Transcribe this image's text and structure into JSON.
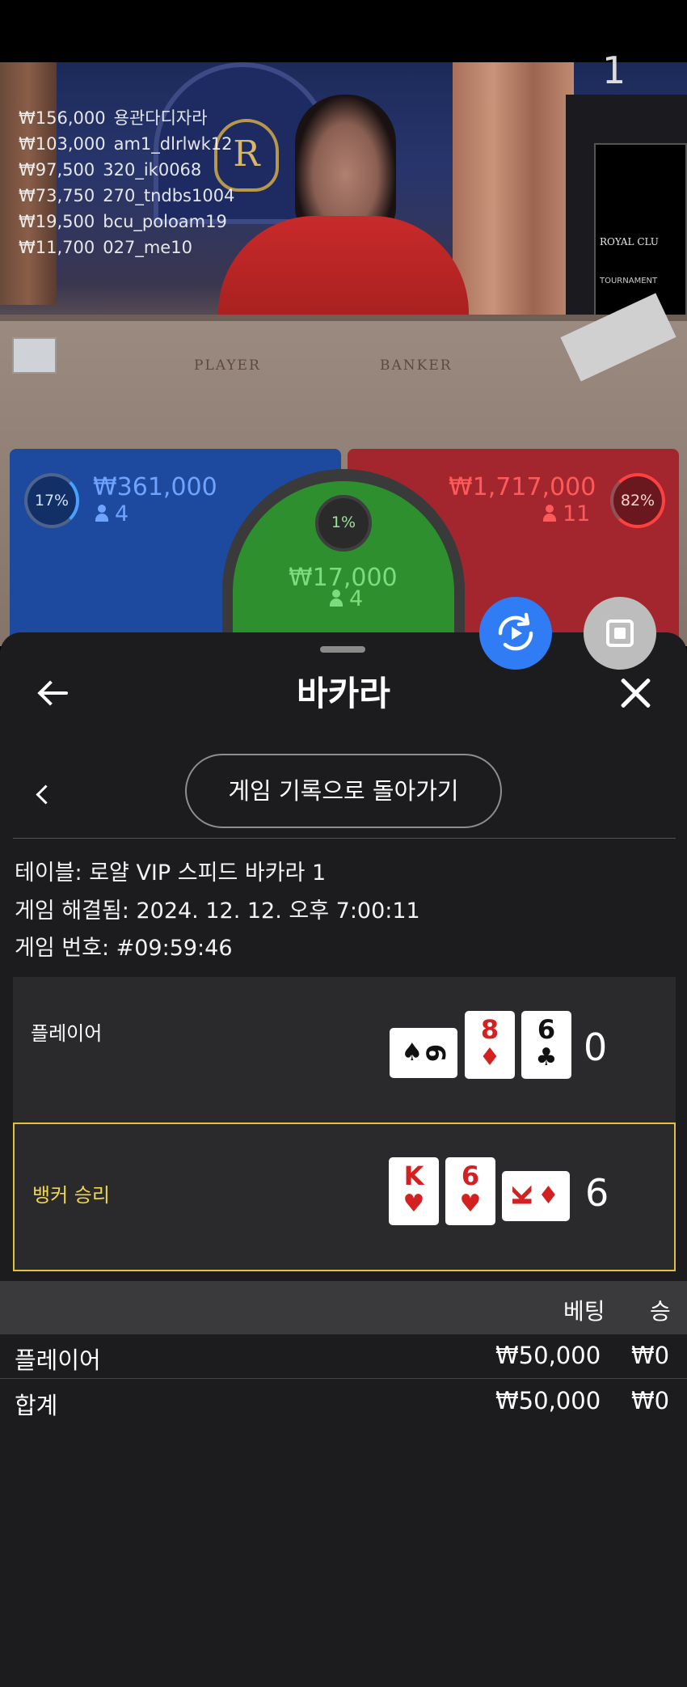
{
  "stage": {
    "round_number": "1",
    "leaderboard": [
      {
        "amount": "₩156,000",
        "user": "용관다디자라"
      },
      {
        "amount": "₩103,000",
        "user": "am1_dlrlwk12"
      },
      {
        "amount": "₩97,500",
        "user": "320_ik0068"
      },
      {
        "amount": "₩73,750",
        "user": "270_tndbs1004"
      },
      {
        "amount": "₩19,500",
        "user": "bcu_poloam19"
      },
      {
        "amount": "₩11,700",
        "user": "027_me10"
      }
    ],
    "table_labels": {
      "player": "PLAYER",
      "banker": "BANKER"
    },
    "sign": {
      "title": "ROYAL CLU",
      "subtitle": "TOURNAMENT"
    },
    "zones": {
      "player": {
        "percent": "17%",
        "amount": "₩361,000",
        "count": "4",
        "color": "#1d4a9e"
      },
      "banker": {
        "percent": "82%",
        "amount": "₩1,717,000",
        "count": "11",
        "color": "#a3262e"
      },
      "tie": {
        "percent": "1%",
        "amount": "₩17,000",
        "count": "4",
        "color": "#2d8f2d"
      }
    }
  },
  "buttons": {
    "replay_icon": "replay-icon",
    "stop_icon": "stop-icon"
  },
  "sheet": {
    "title": "바카라",
    "history_button": "게임 기록으로 돌아가기",
    "info": {
      "table": "테이블: 로얄 VIP 스피드 바카라 1",
      "resolved": "게임 해결됨: 2024. 12. 12. 오후 7:00:11",
      "game_no": "게임 번호: #09:59:46"
    },
    "results": {
      "player": {
        "label": "플레이어",
        "score": "0",
        "cards": [
          {
            "rank": "9",
            "suit": "♠",
            "color": "black",
            "orientation": "sideways"
          },
          {
            "rank": "8",
            "suit": "♦",
            "color": "red",
            "orientation": "upright"
          },
          {
            "rank": "6",
            "suit": "♣",
            "color": "black",
            "orientation": "upright"
          }
        ]
      },
      "banker": {
        "label": "뱅커 승리",
        "score": "6",
        "highlight_color": "#e0c13a",
        "cards": [
          {
            "rank": "K",
            "suit": "♥",
            "color": "red",
            "orientation": "upright"
          },
          {
            "rank": "6",
            "suit": "♥",
            "color": "red",
            "orientation": "upright"
          },
          {
            "rank": "K",
            "suit": "♦",
            "color": "red",
            "orientation": "sideways"
          }
        ]
      }
    },
    "bets": {
      "headers": {
        "bet": "베팅",
        "win": "승"
      },
      "rows": [
        {
          "name": "플레이어",
          "bet": "₩50,000",
          "win": "₩0"
        },
        {
          "name": "합계",
          "bet": "₩50,000",
          "win": "₩0"
        }
      ]
    }
  }
}
